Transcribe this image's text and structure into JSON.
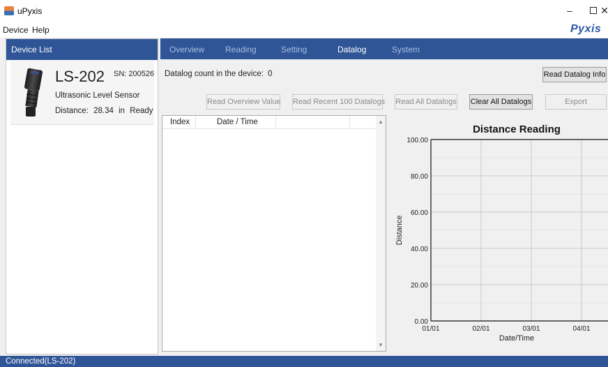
{
  "window": {
    "title": "uPyxis",
    "minimize_icon": "minimize-icon",
    "maximize_icon": "maximize-icon",
    "close_icon": "close-icon"
  },
  "menu": {
    "device": "Device",
    "help": "Help"
  },
  "brand": "Pyxis",
  "device_list": {
    "header": "Device List",
    "device": {
      "model": "LS-202",
      "sn": "SN: 200526",
      "type": "Ultrasonic Level Sensor",
      "distance_label": "Distance:",
      "distance_value": "28.34",
      "distance_unit": "in",
      "status": "Ready"
    }
  },
  "tabs": [
    {
      "label": "Overview",
      "active": false
    },
    {
      "label": "Reading",
      "active": false
    },
    {
      "label": "Setting",
      "active": false
    },
    {
      "label": "Datalog",
      "active": true
    },
    {
      "label": "System",
      "active": false
    }
  ],
  "datalog": {
    "count_label": "Datalog count in the device:",
    "count_value": "0",
    "buttons": {
      "read_info": "Read Datalog Info",
      "read_overview": "Read Overview Value",
      "read_recent": "Read Recent 100 Datalogs",
      "read_all": "Read All Datalogs",
      "clear_all": "Clear All Datalogs",
      "export": "Export"
    },
    "table": {
      "columns": [
        "Index",
        "Date / Time",
        "",
        ""
      ],
      "rows": []
    }
  },
  "chart_data": {
    "type": "line",
    "title": "Distance Reading",
    "xlabel": "Date/Time",
    "ylabel": "Distance",
    "x_ticks": [
      "01/01",
      "02/01",
      "03/01",
      "04/01"
    ],
    "y_ticks": [
      "0.00",
      "20.00",
      "40.00",
      "60.00",
      "80.00",
      "100.00"
    ],
    "ylim": [
      0,
      100
    ],
    "series": [],
    "grid": true
  },
  "colors": {
    "accent": "#2f5597",
    "tab_inactive": "#a9bde0",
    "brand": "#2a5aa6"
  },
  "status": {
    "text": "Connected(LS-202)"
  }
}
